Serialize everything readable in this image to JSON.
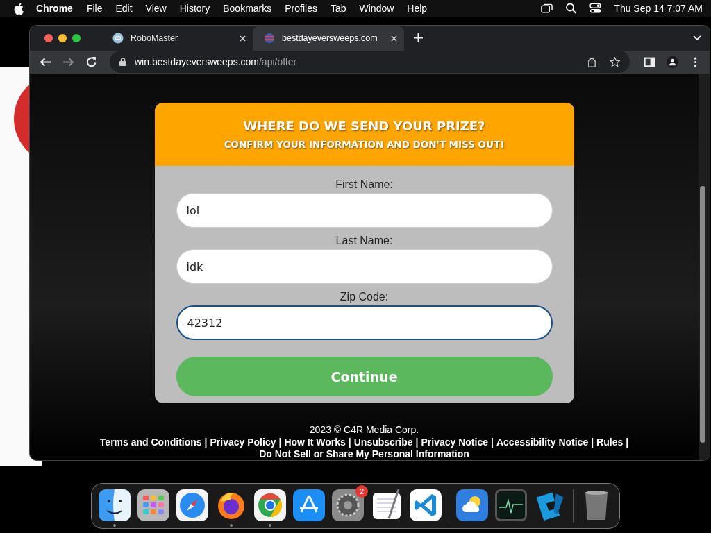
{
  "menu_bar": {
    "app_name": "Chrome",
    "menus": [
      "File",
      "Edit",
      "View",
      "History",
      "Bookmarks",
      "Profiles",
      "Tab",
      "Window",
      "Help"
    ],
    "clock": "Thu Sep 14  7:07 AM"
  },
  "browser": {
    "tabs": [
      {
        "title": "RoboMaster",
        "selected": false,
        "kind": "robot"
      },
      {
        "title": "bestdayeversweeps.com",
        "selected": true,
        "kind": "globe"
      }
    ],
    "address_bar": {
      "host": "win.bestdayeversweeps.com",
      "path": "/api/offer"
    }
  },
  "form_card": {
    "title": "WHERE DO WE SEND YOUR PRIZE?",
    "subtitle": "CONFIRM YOUR INFORMATION AND DON'T MISS OUT!",
    "fields": [
      {
        "label": "First Name:",
        "value": "lol",
        "focused": false
      },
      {
        "label": "Last Name:",
        "value": "idk",
        "focused": false
      },
      {
        "label": "Zip Code:",
        "value": "42312",
        "focused": true
      }
    ],
    "button": "Continue"
  },
  "footer": {
    "copyright": "2023 © C4R Media Corp.",
    "separator": "|",
    "links": [
      "Terms and Conditions",
      "Privacy Policy",
      "How It Works",
      "Unsubscribe",
      "Privacy Notice",
      "Accessibility Notice",
      "Rules",
      "Do Not Sell or Share My Personal Information"
    ]
  },
  "dock": {
    "groups": [
      {
        "items": [
          {
            "kind": "finder",
            "running": true
          },
          {
            "kind": "launchpad",
            "running": false
          },
          {
            "kind": "safari",
            "running": false
          },
          {
            "kind": "firefox",
            "running": true
          },
          {
            "kind": "chrome",
            "running": true
          },
          {
            "kind": "appstore",
            "running": false
          },
          {
            "kind": "settings",
            "running": false,
            "badge": "2"
          },
          {
            "kind": "textedit",
            "running": false
          },
          {
            "kind": "vscode",
            "running": false
          }
        ]
      },
      {
        "items": [
          {
            "kind": "weather",
            "running": false
          },
          {
            "kind": "activity",
            "running": false
          },
          {
            "kind": "blocks",
            "running": false
          }
        ]
      },
      {
        "items": [
          {
            "kind": "trash",
            "running": false
          }
        ]
      }
    ]
  }
}
